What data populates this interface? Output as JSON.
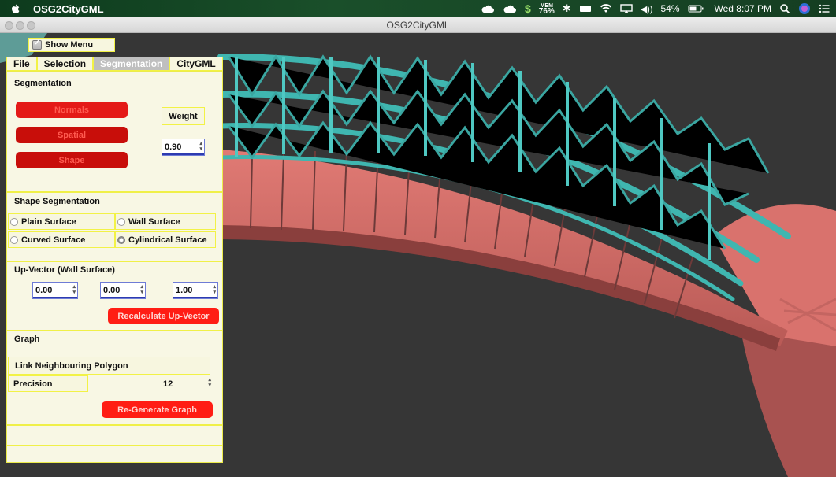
{
  "menubar": {
    "app_name": "OSG2CityGML",
    "mem_label": "MEM",
    "mem_value": "76%",
    "battery_percent": "54%",
    "clock": "Wed 8:07 PM"
  },
  "window": {
    "title": "OSG2CityGML"
  },
  "show_menu": {
    "label": "Show Menu",
    "checked": true
  },
  "tabs": [
    {
      "label": "File",
      "active": false
    },
    {
      "label": "Selection",
      "active": false
    },
    {
      "label": "Segmentation",
      "active": true
    },
    {
      "label": "CityGML",
      "active": false
    }
  ],
  "segmentation": {
    "title": "Segmentation",
    "buttons": {
      "normals": "Normals",
      "spatial": "Spatial",
      "shape": "Shape"
    },
    "weight_label": "Weight",
    "weight_value": "0.90"
  },
  "shape_segmentation": {
    "title": "Shape Segmentation",
    "options": {
      "plain": "Plain Surface",
      "wall": "Wall Surface",
      "curved": "Curved Surface",
      "cylindrical": "Cylindrical Surface"
    },
    "selected": "Cylindrical Surface"
  },
  "up_vector": {
    "title": "Up-Vector (Wall Surface)",
    "x": "0.00",
    "y": "0.00",
    "z": "1.00",
    "recalc_label": "Recalculate Up-Vector"
  },
  "graph": {
    "title": "Graph",
    "link_label": "Link Neighbouring Polygon",
    "precision_label": "Precision",
    "precision_value": "12",
    "regen_label": "Re-Generate Graph"
  },
  "colors": {
    "truss": "#3fb6b0",
    "deck": "#d4706b",
    "button_red": "#e41a17",
    "panel_bg": "#f8f7e4",
    "panel_border": "#ecec4a"
  }
}
